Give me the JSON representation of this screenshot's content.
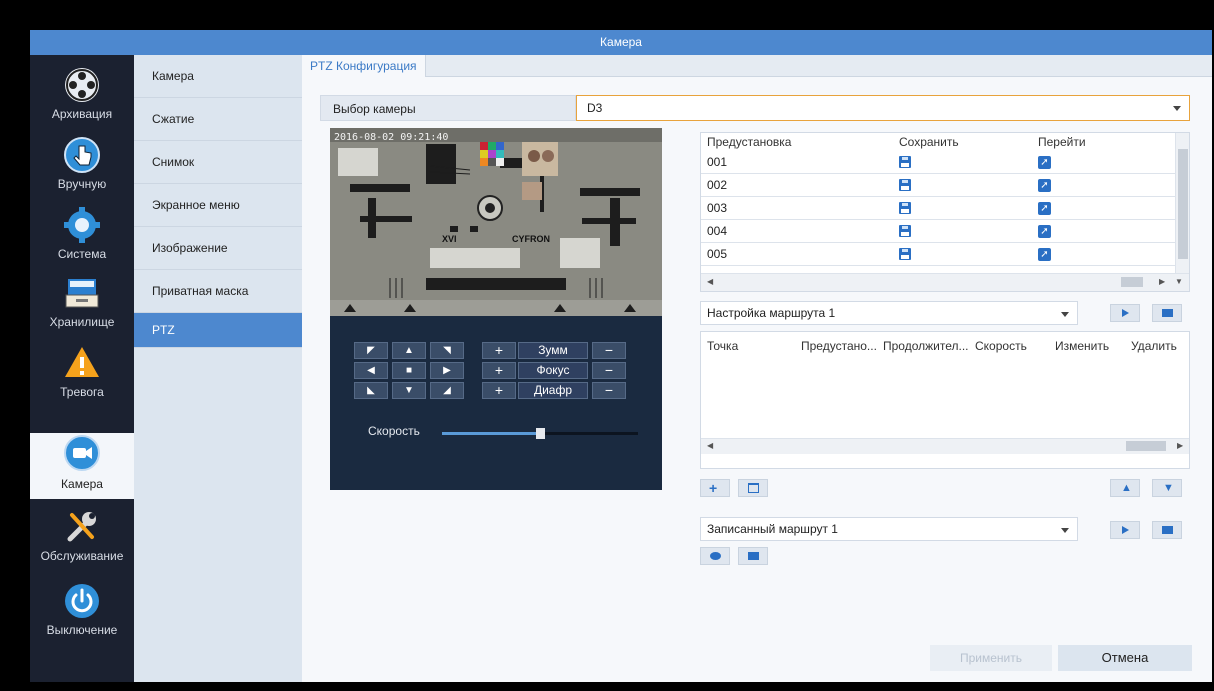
{
  "window_title": "Камера",
  "nav": [
    {
      "label": "Архивация",
      "icon": "archive-icon"
    },
    {
      "label": "Вручную",
      "icon": "manual-icon"
    },
    {
      "label": "Система",
      "icon": "system-gear-icon"
    },
    {
      "label": "Хранилище",
      "icon": "storage-icon"
    },
    {
      "label": "Тревога",
      "icon": "alarm-icon"
    },
    {
      "label": "Камера",
      "icon": "camera-icon"
    },
    {
      "label": "Обслуживание",
      "icon": "maintenance-icon"
    },
    {
      "label": "Выключение",
      "icon": "power-icon"
    }
  ],
  "submenu": [
    "Камера",
    "Сжатие",
    "Снимок",
    "Экранное меню",
    "Изображение",
    "Приватная маска",
    "PTZ"
  ],
  "tab": "PTZ Конфигурация",
  "camera_select": {
    "label": "Выбор камеры",
    "value": "D3"
  },
  "video": {
    "timestamp": "2016-08-02 09:21:40"
  },
  "ptz": {
    "zoom": "Зумм",
    "focus": "Фокус",
    "iris": "Диафр",
    "speed_label": "Скорость",
    "speed_value": 0.5
  },
  "presets": {
    "headers": {
      "preset": "Предустановка",
      "save": "Сохранить",
      "goto": "Перейти"
    },
    "rows": [
      "001",
      "002",
      "003",
      "004",
      "005"
    ]
  },
  "route": {
    "select": "Настройка маршрута 1",
    "headers": {
      "point": "Точка",
      "preset": "Предустано...",
      "duration": "Продолжител...",
      "speed": "Скорость",
      "edit": "Изменить",
      "delete": "Удалить"
    }
  },
  "recorded": {
    "select": "Записанный маршрут 1"
  },
  "buttons": {
    "apply": "Применить",
    "cancel": "Отмена"
  },
  "colors": {
    "accent": "#4d88cf",
    "nav_bg": "#1b2130",
    "icon_blue": "#2a6fc4"
  }
}
